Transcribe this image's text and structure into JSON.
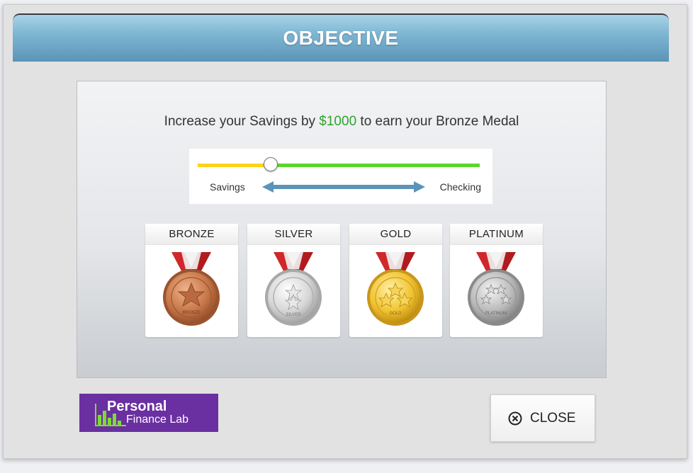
{
  "header": {
    "title": "OBJECTIVE"
  },
  "objective": {
    "prefix": "Increase your Savings by ",
    "amount": "$1000",
    "suffix": " to earn your Bronze Medal",
    "amount_color": "#2fa32f"
  },
  "slider": {
    "left_label": "Savings",
    "right_label": "Checking",
    "savings_color": "#ffd21c",
    "checking_color": "#5bd62d",
    "arrow_color": "#5b94b7",
    "position_fraction": 0.26
  },
  "medals": [
    {
      "title": "BRONZE",
      "inscription": "BRONZE",
      "icon": "bronze-medal-icon",
      "color": "#c8784a"
    },
    {
      "title": "SILVER",
      "inscription": "SILVER",
      "icon": "silver-medal-icon",
      "color": "#d6d6d6"
    },
    {
      "title": "GOLD",
      "inscription": "GOLD",
      "icon": "gold-medal-icon",
      "color": "#f0c431"
    },
    {
      "title": "PLATINUM",
      "inscription": "PLATINUM",
      "icon": "platinum-medal-icon",
      "color": "#b9b9b9"
    }
  ],
  "logo": {
    "line1": "Personal",
    "line2": "Finance Lab",
    "color": "#6a2fa0"
  },
  "close_button": {
    "label": "CLOSE",
    "icon": "close-circle-icon"
  }
}
